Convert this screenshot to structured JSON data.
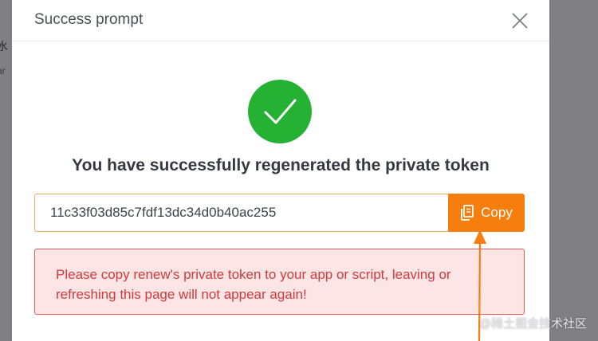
{
  "background": {
    "fragment_1": "水",
    "fragment_2": "ar"
  },
  "modal": {
    "title": "Success prompt",
    "close_icon": "close-icon",
    "success_icon": "checkmark-icon",
    "headline": "You have successfully regenerated the private token",
    "token_value": "11c33f03d85c7fdf13dc34d0b40ac255",
    "copy_button": {
      "label": "Copy",
      "icon": "copy-icon",
      "color": "#f57e0f"
    },
    "alert": {
      "text": "Please copy renew's private token to your app or script, leaving or refreshing this page will not appear again!",
      "color": "#d23a3a",
      "background": "#fde5e5"
    }
  },
  "annotation": {
    "arrow_color": "#f57e0f"
  },
  "watermark": "@稀土掘金技术社区",
  "colors": {
    "success_green": "#25b133",
    "accent_orange": "#f57e0f"
  }
}
